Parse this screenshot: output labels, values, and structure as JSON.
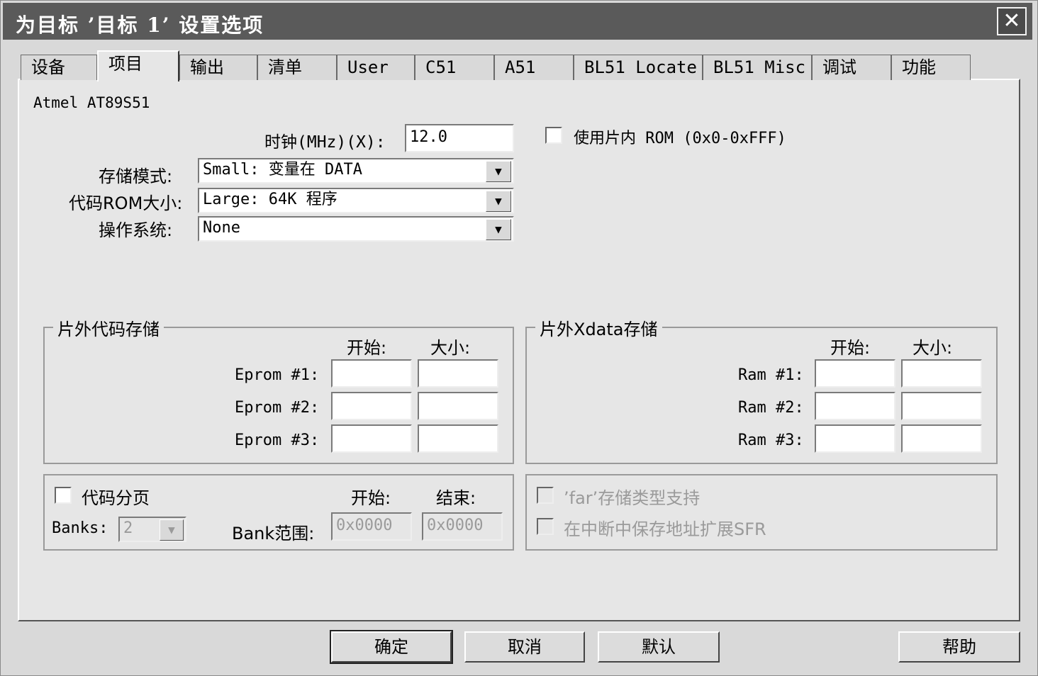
{
  "window": {
    "title": "为目标 ’目标 1’ 设置选项",
    "close_glyph": "✕"
  },
  "tabs": [
    {
      "label": "设备"
    },
    {
      "label": "项目"
    },
    {
      "label": "输出"
    },
    {
      "label": "清单"
    },
    {
      "label": "User"
    },
    {
      "label": "C51"
    },
    {
      "label": "A51"
    },
    {
      "label": "BL51 Locate"
    },
    {
      "label": "BL51 Misc"
    },
    {
      "label": "调试"
    },
    {
      "label": "功能"
    }
  ],
  "device": "Atmel AT89S51",
  "clock": {
    "label": "时钟(MHz)(X):",
    "value": "12.0"
  },
  "onchip_rom": {
    "label": "使用片内 ROM (0x0-0xFFF)"
  },
  "memory_model": {
    "label": "存储模式:",
    "value": "Small: 变量在 DATA"
  },
  "code_rom_size": {
    "label": "代码ROM大小:",
    "value": "Large: 64K 程序"
  },
  "os": {
    "label": "操作系统:",
    "value": "None"
  },
  "offchip_code": {
    "title": "片外代码存储",
    "start_label": "开始:",
    "size_label": "大小:",
    "rows": [
      {
        "label": "Eprom #1:"
      },
      {
        "label": "Eprom #2:"
      },
      {
        "label": "Eprom #3:"
      }
    ]
  },
  "offchip_xdata": {
    "title": "片外Xdata存储",
    "start_label": "开始:",
    "size_label": "大小:",
    "rows": [
      {
        "label": "Ram #1:"
      },
      {
        "label": "Ram #2:"
      },
      {
        "label": "Ram #3:"
      }
    ]
  },
  "code_banking": {
    "label": "代码分页",
    "start_label": "开始:",
    "end_label": "结束:",
    "banks_label": "Banks:",
    "banks_value": "2",
    "range_label": "Bank范围:",
    "range_start": "0x0000",
    "range_end": "0x0000"
  },
  "far_support": {
    "label": "’far’存储类型支持"
  },
  "save_sfr": {
    "label": "在中断中保存地址扩展SFR"
  },
  "buttons": {
    "ok": "确定",
    "cancel": "取消",
    "defaults": "默认",
    "help": "帮助"
  },
  "icons": {
    "dropdown": "▼"
  }
}
